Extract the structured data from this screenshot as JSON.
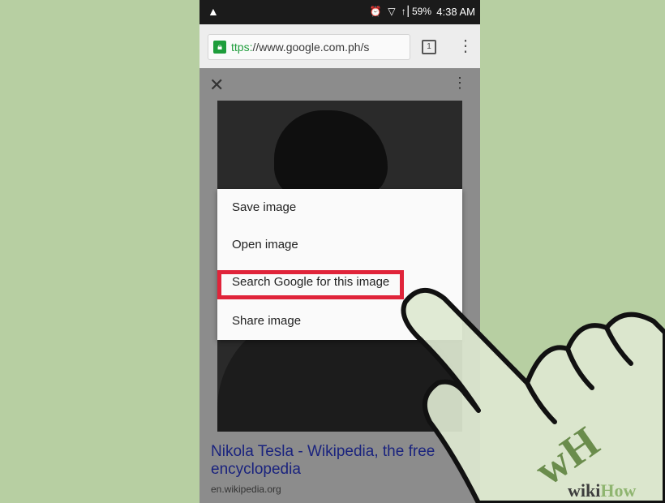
{
  "status_bar": {
    "warning_icon": "warning-triangle-icon",
    "icons": "⏰ ▽ ↑▏",
    "battery_percent": "59%",
    "time": "4:38 AM"
  },
  "browser": {
    "url_scheme": "ttps:",
    "url_rest": "//www.google.com.ph/s",
    "tab_count": "1"
  },
  "image_viewer": {
    "close_icon": "close-icon",
    "more_icon": "more-vert-icon"
  },
  "context_menu": {
    "items": [
      {
        "label": "Save image"
      },
      {
        "label": "Open image"
      },
      {
        "label": "Search Google for this image"
      },
      {
        "label": "Share image"
      }
    ],
    "highlighted_index": 2,
    "highlight_color": "#e0243a"
  },
  "search_result": {
    "title": "Nikola Tesla - Wikipedia, the free encyclopedia",
    "url": "en.wikipedia.org"
  },
  "watermark": {
    "wiki": "wiki",
    "how": "How",
    "badge": "wH"
  },
  "colors": {
    "background": "#b7cfa2",
    "secure_green": "#1e9d3b",
    "link_color": "#1a237e"
  }
}
